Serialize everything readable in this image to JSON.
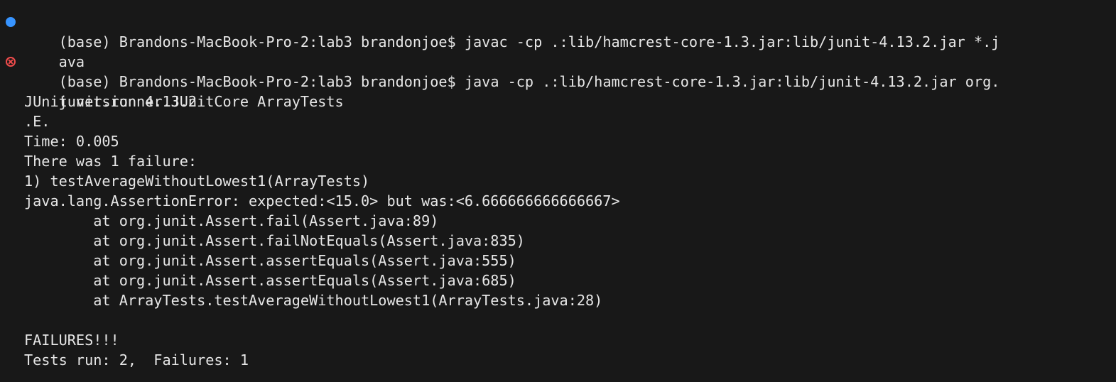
{
  "terminal": {
    "command1": {
      "status": "success",
      "lines": [
        "(base) Brandons-MacBook-Pro-2:lab3 brandonjoe$ javac -cp .:lib/hamcrest-core-1.3.jar:lib/junit-4.13.2.jar *.j",
        "ava"
      ]
    },
    "command2": {
      "status": "error",
      "lines": [
        "(base) Brandons-MacBook-Pro-2:lab3 brandonjoe$ java -cp .:lib/hamcrest-core-1.3.jar:lib/junit-4.13.2.jar org.",
        "junit.runner.JUnitCore ArrayTests"
      ]
    },
    "output": [
      "JUnit version 4.13.2",
      ".E.",
      "Time: 0.005",
      "There was 1 failure:",
      "1) testAverageWithoutLowest1(ArrayTests)",
      "java.lang.AssertionError: expected:<15.0> but was:<6.666666666666667>",
      "        at org.junit.Assert.fail(Assert.java:89)",
      "        at org.junit.Assert.failNotEquals(Assert.java:835)",
      "        at org.junit.Assert.assertEquals(Assert.java:555)",
      "        at org.junit.Assert.assertEquals(Assert.java:685)",
      "        at ArrayTests.testAverageWithoutLowest1(ArrayTests.java:28)",
      "",
      "FAILURES!!!",
      "Tests run: 2,  Failures: 1"
    ],
    "colors": {
      "background": "#181818",
      "text": "#e6e6e6",
      "success_marker": "#3794ff",
      "error_marker": "#f14c4c"
    }
  }
}
